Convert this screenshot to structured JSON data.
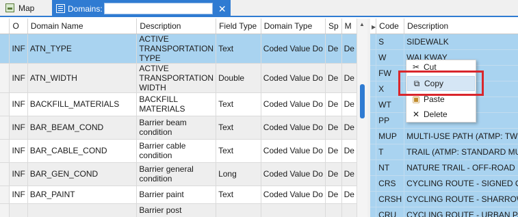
{
  "tabs": {
    "map_label": "Map",
    "domains_label": "Domains:",
    "domains_field_value": "",
    "close_glyph": "✕"
  },
  "left_grid": {
    "columns": [
      "",
      "O",
      "Domain Name",
      "Description",
      "Field Type",
      "Domain Type",
      "Sp",
      "M"
    ],
    "rows": [
      {
        "o": "INF",
        "name": "ATN_TYPE",
        "desc": "ACTIVE TRANSPORTATION TYPE",
        "field_type": "Text",
        "domain_type": "Coded Value Do",
        "sp": "De",
        "m": "De"
      },
      {
        "o": "INF",
        "name": "ATN_WIDTH",
        "desc": "ACTIVE TRANSPORTATION WIDTH",
        "field_type": "Double",
        "domain_type": "Coded Value Do",
        "sp": "De",
        "m": "De"
      },
      {
        "o": "INF",
        "name": "BACKFILL_MATERIALS",
        "desc": "BACKFILL MATERIALS",
        "field_type": "Text",
        "domain_type": "Coded Value Do",
        "sp": "De",
        "m": "De"
      },
      {
        "o": "INF",
        "name": "BAR_BEAM_COND",
        "desc": "Barrier beam condition",
        "field_type": "Text",
        "domain_type": "Coded Value Do",
        "sp": "De",
        "m": "De"
      },
      {
        "o": "INF",
        "name": "BAR_CABLE_COND",
        "desc": "Barrier cable condition",
        "field_type": "Text",
        "domain_type": "Coded Value Do",
        "sp": "De",
        "m": "De"
      },
      {
        "o": "INF",
        "name": "BAR_GEN_COND",
        "desc": "Barrier general condition",
        "field_type": "Long",
        "domain_type": "Coded Value Do",
        "sp": "De",
        "m": "De"
      },
      {
        "o": "INF",
        "name": "BAR_PAINT",
        "desc": "Barrier paint",
        "field_type": "Text",
        "domain_type": "Coded Value Do",
        "sp": "De",
        "m": "De"
      },
      {
        "o": "",
        "name": "",
        "desc": "Barrier post",
        "field_type": "",
        "domain_type": "",
        "sp": "",
        "m": ""
      }
    ]
  },
  "right_grid": {
    "columns": [
      "",
      "Code",
      "Description"
    ],
    "rows": [
      {
        "code": "S",
        "desc": "SIDEWALK"
      },
      {
        "code": "W",
        "desc": "WALKWAY"
      },
      {
        "code": "FW",
        "desc": ""
      },
      {
        "code": "X",
        "desc": ""
      },
      {
        "code": "WT",
        "desc": ""
      },
      {
        "code": "PP",
        "desc": ""
      },
      {
        "code": "MUP",
        "desc": "MULTI-USE PATH (ATMP: TWO-"
      },
      {
        "code": "T",
        "desc": "TRAIL (ATMP: STANDARD MULT"
      },
      {
        "code": "NT",
        "desc": "NATURE TRAIL - OFF-ROAD RU"
      },
      {
        "code": "CRS",
        "desc": "CYCLING ROUTE - SIGNED ONL"
      },
      {
        "code": "CRSH",
        "desc": "CYCLING ROUTE - SHARROWS"
      },
      {
        "code": "CRU",
        "desc": "CYCLING ROUTE - URBAN PAV"
      }
    ]
  },
  "context_menu": {
    "items": [
      {
        "label": "Cut",
        "icon": "scissors-icon"
      },
      {
        "label": "Copy",
        "icon": "copy-icon"
      },
      {
        "label": "Paste",
        "icon": "paste-icon"
      },
      {
        "label": "Delete",
        "icon": "delete-icon"
      }
    ]
  },
  "colors": {
    "accent": "#2f7bd2",
    "selection": "#a9d3f0",
    "highlight_box": "#d9262c"
  }
}
